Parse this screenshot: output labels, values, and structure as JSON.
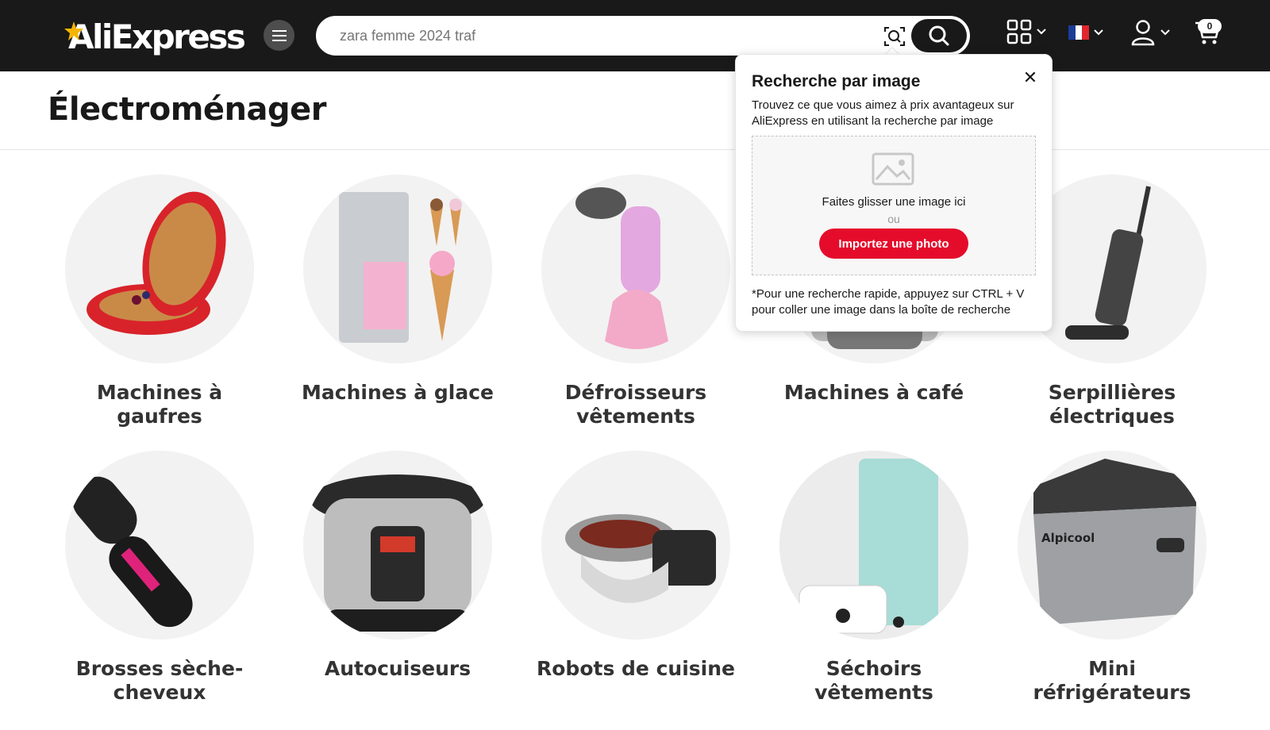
{
  "header": {
    "logo_text": "AliExpress",
    "search": {
      "value": "zara femme 2024 traf",
      "placeholder": "zara femme 2024 traf"
    },
    "icons": [
      "menu-icon",
      "camera-search-icon",
      "search-icon",
      "qr-code-icon",
      "flag-fr-icon",
      "user-icon",
      "cart-icon"
    ],
    "cart_count": "0"
  },
  "page": {
    "title": "Électroménager"
  },
  "categories": [
    {
      "label": "Machines à gaufres"
    },
    {
      "label": "Machines à glace"
    },
    {
      "label": "Défroisseurs vêtements"
    },
    {
      "label": "Machines à café"
    },
    {
      "label": "Serpillières électriques"
    },
    {
      "label": "Brosses sèche-cheveux"
    },
    {
      "label": "Autocuiseurs"
    },
    {
      "label": "Robots de cuisine"
    },
    {
      "label": "Séchoirs vêtements"
    },
    {
      "label": "Mini réfrigérateurs"
    }
  ],
  "image_search_popup": {
    "title": "Recherche par image",
    "description": "Trouvez ce que vous aimez à prix avantageux sur AliExpress en utilisant la recherche par image",
    "drop_text": "Faites glisser une image ici",
    "or_text": "ou",
    "upload_label": "Importez une photo",
    "tip": "*Pour une recherche rapide, appuyez sur CTRL + V pour coller une image dans la boîte de recherche"
  },
  "colors": {
    "header_bg": "#191919",
    "accent_red": "#e50c2b",
    "logo_star": "#f7b500"
  }
}
